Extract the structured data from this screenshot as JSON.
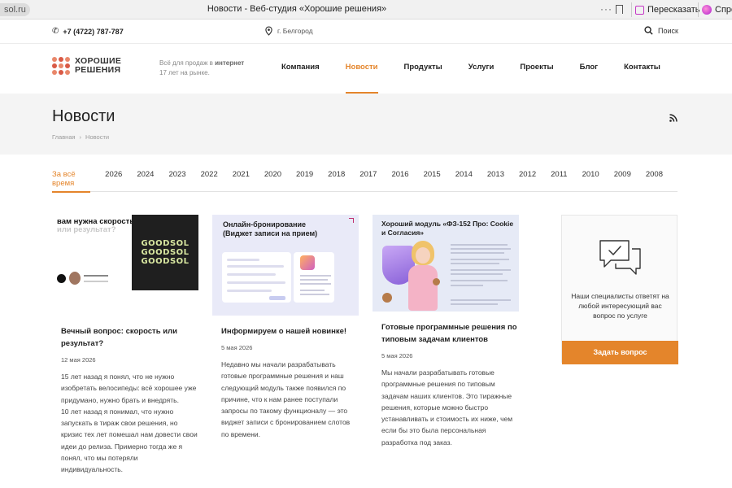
{
  "browser": {
    "url": "sol.ru",
    "tab_title": "Новости - Веб-студия «Хорошие решения»",
    "dots": "···",
    "retell_label": "Пересказать",
    "ask_label": "Спро"
  },
  "topbar": {
    "phone": "+7 (4722) 787-787",
    "city": "г. Белгород",
    "search_label": "Поиск"
  },
  "header": {
    "logo_line1": "ХОРОШИЕ",
    "logo_line2": "РЕШЕНИЯ",
    "tagline_part1": "Всё для продаж в ",
    "tagline_bold": "интернет",
    "tagline_part2": "17 лет на рынке.",
    "nav": [
      {
        "label": "Компания"
      },
      {
        "label": "Новости"
      },
      {
        "label": "Продукты"
      },
      {
        "label": "Услуги"
      },
      {
        "label": "Проекты"
      },
      {
        "label": "Блог"
      },
      {
        "label": "Контакты"
      }
    ],
    "active_nav": "Новости"
  },
  "title_band": {
    "title": "Новости",
    "breadcrumb_home": "Главная",
    "breadcrumb_sep": "›",
    "breadcrumb_current": "Новости"
  },
  "years": [
    "За всё время",
    "2026",
    "2024",
    "2023",
    "2022",
    "2021",
    "2020",
    "2019",
    "2018",
    "2017",
    "2016",
    "2015",
    "2014",
    "2013",
    "2012",
    "2011",
    "2010",
    "2009",
    "2008"
  ],
  "active_year": "За всё время",
  "cards": [
    {
      "img_question": "вам нужна скорость —",
      "img_question_dim": "или результат?",
      "img_brand": "GOODSOL",
      "title": "Вечный вопрос: скорость или результат?",
      "date": "12 мая 2026",
      "text": "15 лет назад я понял, что не нужно изобретать велосипеды: всё хорошее уже придумано, нужно брать и внедрять.\n10 лет назад я понимал, что нужно запускать в тираж свои решения, но кризис тех лет помешал нам довести свои идеи до релиза. Примерно тогда же я понял, что мы потеряли индивидуальность."
    },
    {
      "img_heading": "Онлайн-бронирование (Виджет записи на прием)",
      "title": "Информируем о нашей новинке!",
      "date": "5 мая 2026",
      "text": "Недавно мы начали разрабатывать готовые программные решения и наш следующий модуль также появился по причине, что к нам ранее поступали запросы по такому функционалу — это виджет записи с бронированием слотов по времени."
    },
    {
      "img_heading": "Хороший модуль «ФЗ-152 Про: Cookie и Согласия»",
      "title": "Готовые программные решения по типовым задачам клиентов",
      "date": "5 мая 2026",
      "text": "Мы начали разрабатывать готовые программные решения по типовым задачам наших клиентов. Это тиражные решения, которые можно быстро устанавливать и стоимость их ниже, чем если бы это была персональная разработка под заказ."
    }
  ],
  "aside": {
    "text": "Наши специалисты ответят на любой интересующий вас вопрос по услуге",
    "button": "Задать вопрос"
  },
  "colors": {
    "accent": "#e4852b",
    "band": "#f4f4f4"
  }
}
